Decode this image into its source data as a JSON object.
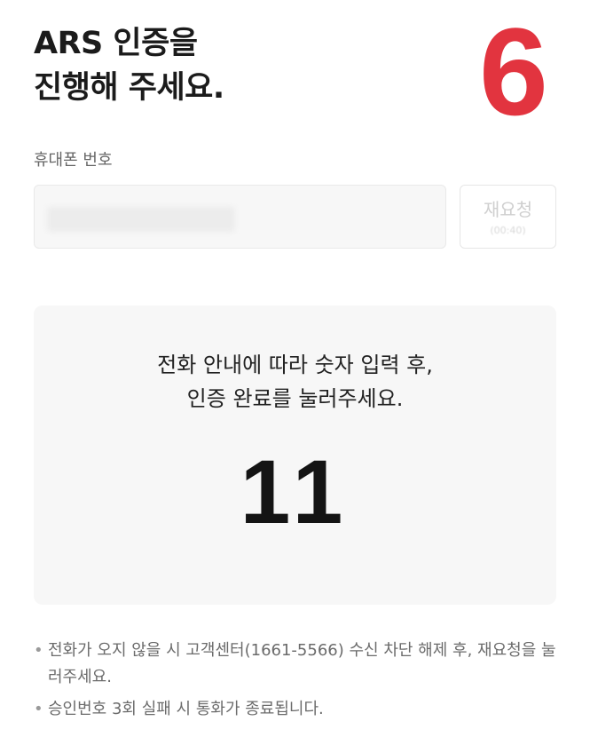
{
  "header": {
    "title_line1": "ARS 인증을",
    "title_line2": "진행해 주세요.",
    "step_number": "6"
  },
  "phone": {
    "label": "휴대폰 번호",
    "value_masked": true
  },
  "resend": {
    "label": "재요청",
    "timer": "(00:40)"
  },
  "ars": {
    "guide_line1": "전화 안내에 따라 숫자 입력 후,",
    "guide_line2": "인증 완료를 눌러주세요.",
    "code": "11"
  },
  "notes": [
    "전화가 오지 않을 시 고객센터(1661-5566) 수신 차단 해제 후, 재요청을 눌러주세요.",
    "승인번호 3회 실패 시 통화가 종료됩니다."
  ],
  "colors": {
    "accent_red": "#e2343f",
    "panel_bg": "#f7f7f7",
    "muted_text": "#6b6b6b"
  }
}
